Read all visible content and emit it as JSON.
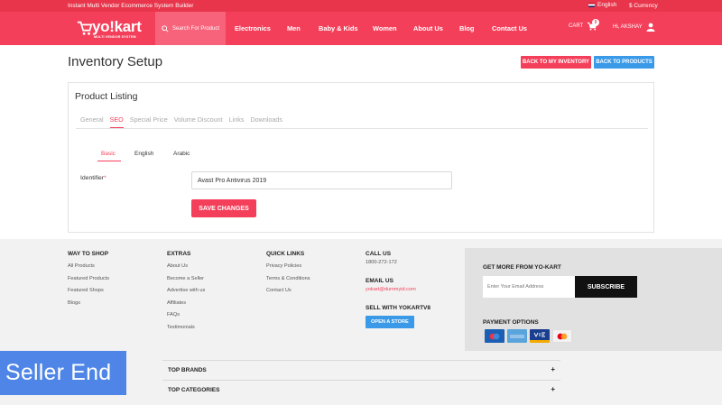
{
  "topbar": {
    "tagline": "Instant Multi Vendor Ecommerce System Builder",
    "language": "English",
    "currency": "$ Currency"
  },
  "header": {
    "logo_text": "yo!kart",
    "logo_sub": "MULTI VENDOR SYSTEM",
    "search_label": "Search For Product",
    "nav": [
      "Electronics",
      "Men",
      "Baby & Kids",
      "Women",
      "About Us",
      "Blog",
      "Contact Us"
    ],
    "cart_label": "CART",
    "cart_count": "0",
    "user_label": "Hi, AKSHAY"
  },
  "page": {
    "title": "Inventory Setup",
    "back_inventory": "BACK TO MY INVENTORY",
    "back_products": "BACK TO PRODUCTS"
  },
  "card": {
    "title": "Product Listing",
    "tabs": [
      "General",
      "SEO",
      "Special Price",
      "Volume Discount",
      "Links",
      "Downloads"
    ],
    "active_tab": "SEO",
    "lang_tabs": [
      "Basic",
      "English",
      "Arabic"
    ],
    "identifier_label": "Identifier",
    "identifier_required": "*",
    "identifier_value": "Avast Pro Antivirus 2019",
    "save_label": "SAVE CHANGES"
  },
  "footer": {
    "way_to_shop": {
      "title": "WAY TO SHOP",
      "links": [
        "All Products",
        "Featured Products",
        "Featured Shops",
        "Blogs"
      ]
    },
    "extras": {
      "title": "EXTRAS",
      "links": [
        "About Us",
        "Become a Seller",
        "Advertise with us",
        "Affiliates",
        "FAQs",
        "Testimonials"
      ]
    },
    "quick_links": {
      "title": "QUICK LINKS",
      "links": [
        "Privacy Policies",
        "Terms & Conditions",
        "Contact Us"
      ]
    },
    "contact": {
      "call_title": "CALL US",
      "phone": "1800-272-172",
      "email_title": "EMAIL US",
      "email": "yokart@dummyid.com",
      "sell_title": "SELL WITH YOKARTV8",
      "open_store": "OPEN A STORE"
    },
    "newsletter": {
      "title": "GET MORE FROM YO-KART",
      "placeholder": "Enter Your Email Address",
      "subscribe": "SUBSCRIBE",
      "payment_title": "PAYMENT OPTIONS",
      "payment_cards": [
        "MAESTRO",
        "AMEX",
        "VISA",
        "MASTERCARD"
      ]
    },
    "top_brands": "TOP BRANDS",
    "top_categories": "TOP CATEGORIES",
    "plus": "+"
  },
  "overlay": {
    "seller_end": "Seller End"
  },
  "colors": {
    "brand": "#f43f5a",
    "blue": "#3a9ae8",
    "overlay": "#4e85e6"
  }
}
